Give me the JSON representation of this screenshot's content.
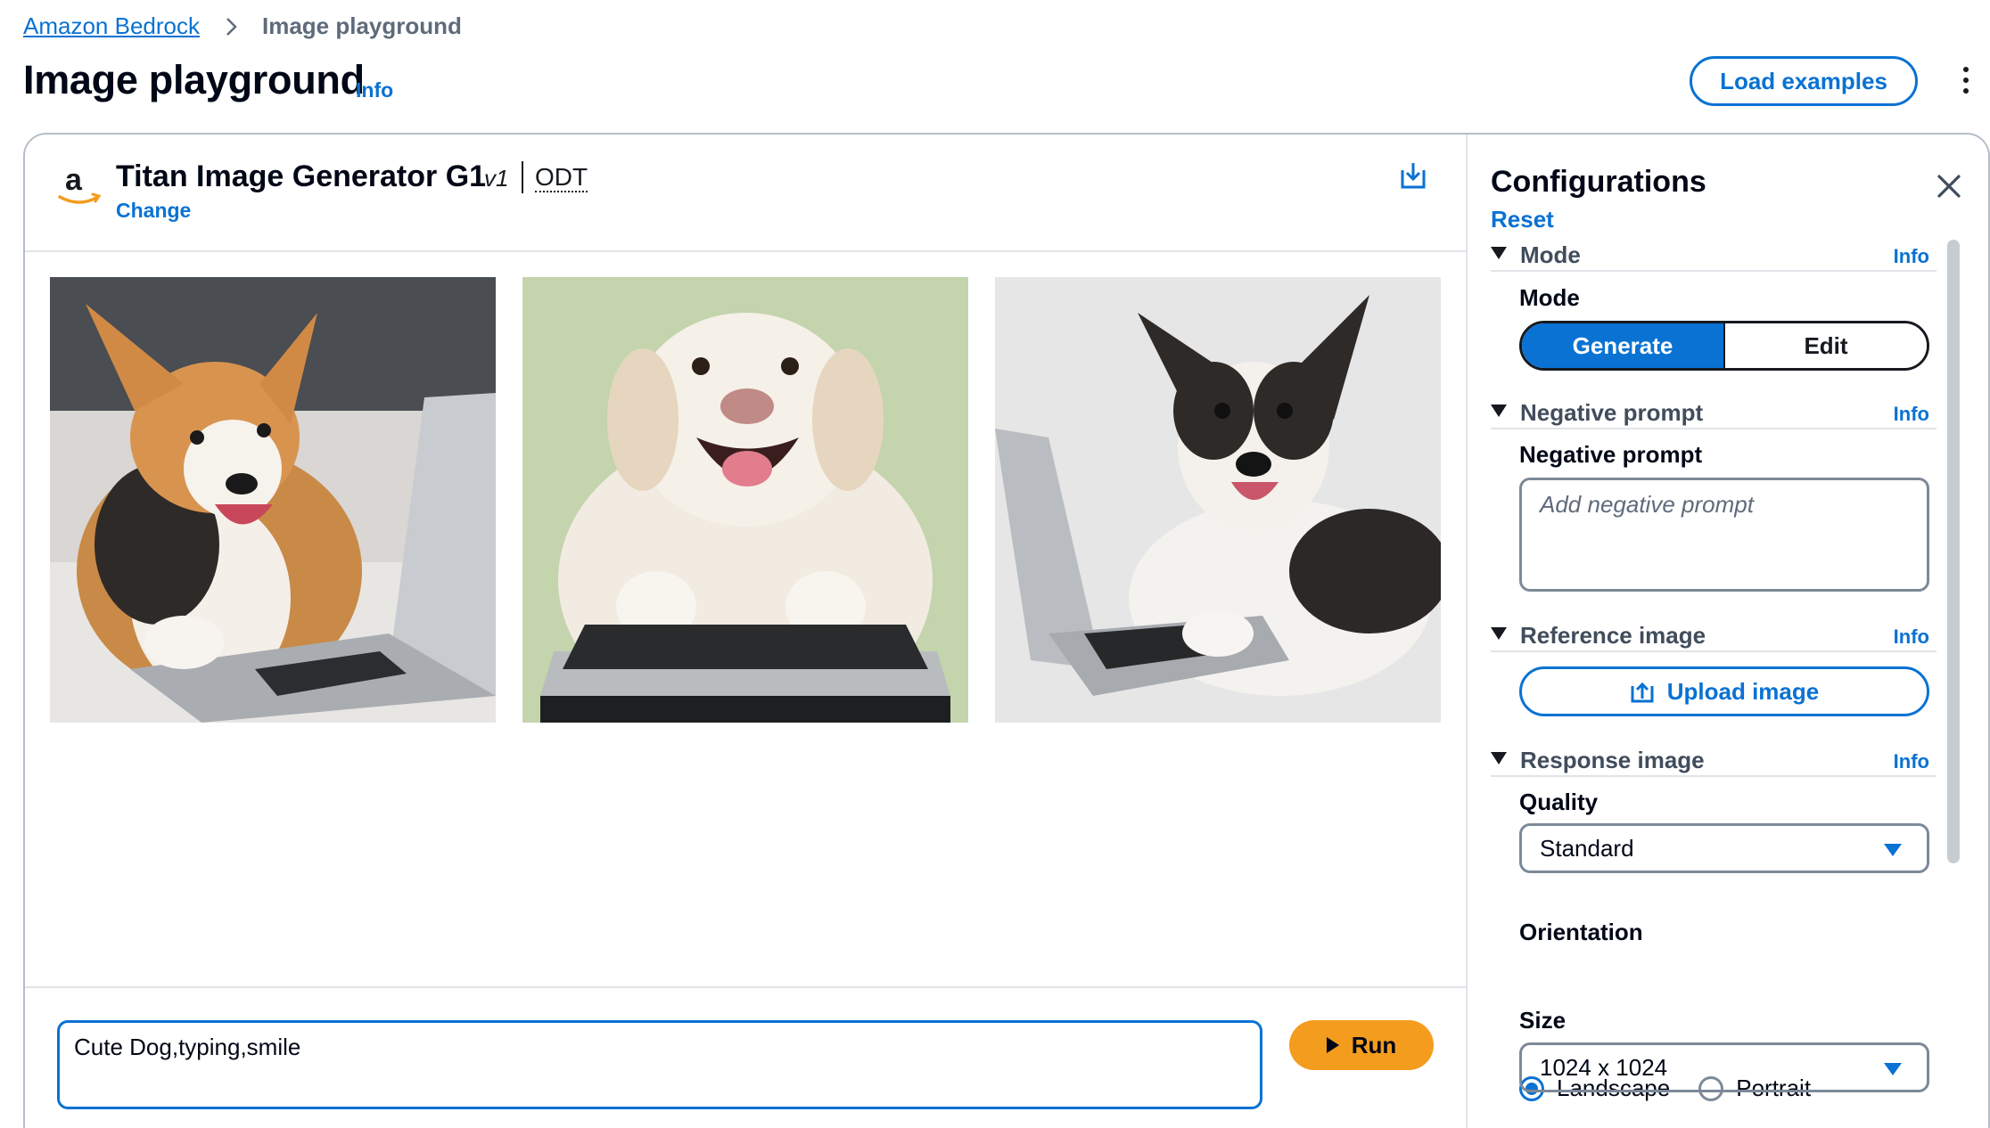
{
  "breadcrumb": {
    "root": "Amazon Bedrock",
    "current": "Image playground"
  },
  "page": {
    "title": "Image playground",
    "info": "Info",
    "load_examples": "Load examples"
  },
  "model": {
    "name": "Titan Image Generator G1",
    "version": "v1",
    "tag": "ODT",
    "change": "Change"
  },
  "images": [
    {
      "alt": "corgi dog smiling at laptop"
    },
    {
      "alt": "white dog smiling with paws on laptop keyboard"
    },
    {
      "alt": "black and white dog smiling beside laptop"
    }
  ],
  "prompt": {
    "value": "Cute Dog,typing,smile",
    "run_label": "Run"
  },
  "config": {
    "title": "Configurations",
    "reset": "Reset",
    "mode_section": {
      "label": "Mode",
      "info": "Info",
      "field_label": "Mode",
      "options": [
        "Generate",
        "Edit"
      ],
      "selected": "Generate"
    },
    "negative_section": {
      "label": "Negative prompt",
      "info": "Info",
      "field_label": "Negative prompt",
      "placeholder": "Add negative prompt"
    },
    "reference_section": {
      "label": "Reference image",
      "info": "Info",
      "upload_label": "Upload image"
    },
    "response_section": {
      "label": "Response image",
      "info": "Info",
      "quality_label": "Quality",
      "quality_value": "Standard",
      "orientation_label": "Orientation",
      "orientation_options": [
        "Landscape",
        "Portrait"
      ],
      "orientation_selected": "Landscape",
      "size_label": "Size",
      "size_value": "1024 x 1024"
    }
  },
  "colors": {
    "accent": "#0972d3",
    "run_button": "#f49c1e",
    "text": "#000716"
  }
}
